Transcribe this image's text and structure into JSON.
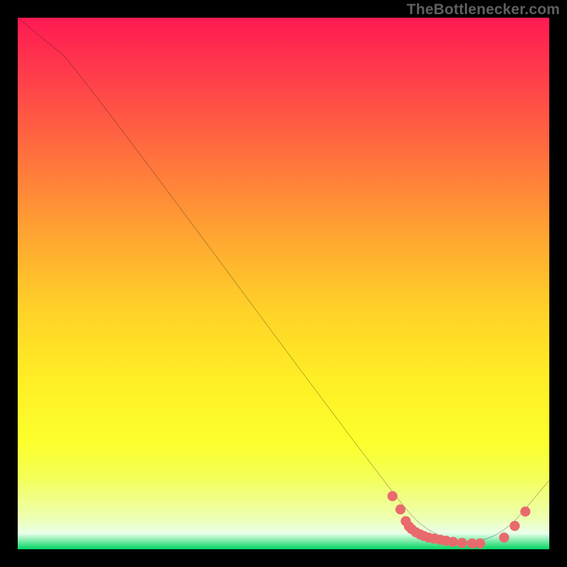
{
  "attribution": "TheBottlenecker.com",
  "chart_data": {
    "type": "line",
    "title": "",
    "xlabel": "",
    "ylabel": "",
    "xlim": [
      0,
      100
    ],
    "ylim": [
      0,
      100
    ],
    "series": [
      {
        "name": "bottleneck-curve",
        "x": [
          0,
          6,
          10,
          70,
          78,
          90,
          100
        ],
        "y": [
          100,
          95,
          92,
          11,
          2,
          1,
          13
        ]
      }
    ],
    "markers": {
      "name": "marker-cluster",
      "points": [
        {
          "x": 70.5,
          "y": 10.0
        },
        {
          "x": 72.0,
          "y": 7.5
        },
        {
          "x": 73.0,
          "y": 5.3
        },
        {
          "x": 73.6,
          "y": 4.3
        },
        {
          "x": 74.1,
          "y": 3.8
        },
        {
          "x": 74.9,
          "y": 3.2
        },
        {
          "x": 75.7,
          "y": 2.8
        },
        {
          "x": 76.4,
          "y": 2.5
        },
        {
          "x": 77.3,
          "y": 2.2
        },
        {
          "x": 78.3,
          "y": 2.0
        },
        {
          "x": 79.5,
          "y": 1.8
        },
        {
          "x": 80.6,
          "y": 1.6
        },
        {
          "x": 81.9,
          "y": 1.4
        },
        {
          "x": 83.6,
          "y": 1.2
        },
        {
          "x": 85.5,
          "y": 1.1
        },
        {
          "x": 87.0,
          "y": 1.1
        },
        {
          "x": 91.5,
          "y": 2.2
        },
        {
          "x": 93.5,
          "y": 4.4
        },
        {
          "x": 95.5,
          "y": 7.1
        }
      ]
    },
    "colors": {
      "curve": "#111111",
      "markers": "#e96a6c",
      "gradient_top": "#ff1a52",
      "gradient_bottom": "#00d562"
    }
  }
}
